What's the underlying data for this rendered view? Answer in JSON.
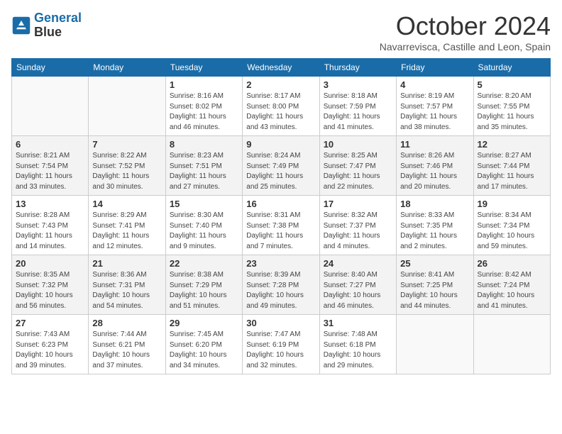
{
  "header": {
    "logo_line1": "General",
    "logo_line2": "Blue",
    "month": "October 2024",
    "location": "Navarrevisca, Castille and Leon, Spain"
  },
  "weekdays": [
    "Sunday",
    "Monday",
    "Tuesday",
    "Wednesday",
    "Thursday",
    "Friday",
    "Saturday"
  ],
  "weeks": [
    [
      {
        "day": "",
        "info": ""
      },
      {
        "day": "",
        "info": ""
      },
      {
        "day": "1",
        "info": "Sunrise: 8:16 AM\nSunset: 8:02 PM\nDaylight: 11 hours and 46 minutes."
      },
      {
        "day": "2",
        "info": "Sunrise: 8:17 AM\nSunset: 8:00 PM\nDaylight: 11 hours and 43 minutes."
      },
      {
        "day": "3",
        "info": "Sunrise: 8:18 AM\nSunset: 7:59 PM\nDaylight: 11 hours and 41 minutes."
      },
      {
        "day": "4",
        "info": "Sunrise: 8:19 AM\nSunset: 7:57 PM\nDaylight: 11 hours and 38 minutes."
      },
      {
        "day": "5",
        "info": "Sunrise: 8:20 AM\nSunset: 7:55 PM\nDaylight: 11 hours and 35 minutes."
      }
    ],
    [
      {
        "day": "6",
        "info": "Sunrise: 8:21 AM\nSunset: 7:54 PM\nDaylight: 11 hours and 33 minutes."
      },
      {
        "day": "7",
        "info": "Sunrise: 8:22 AM\nSunset: 7:52 PM\nDaylight: 11 hours and 30 minutes."
      },
      {
        "day": "8",
        "info": "Sunrise: 8:23 AM\nSunset: 7:51 PM\nDaylight: 11 hours and 27 minutes."
      },
      {
        "day": "9",
        "info": "Sunrise: 8:24 AM\nSunset: 7:49 PM\nDaylight: 11 hours and 25 minutes."
      },
      {
        "day": "10",
        "info": "Sunrise: 8:25 AM\nSunset: 7:47 PM\nDaylight: 11 hours and 22 minutes."
      },
      {
        "day": "11",
        "info": "Sunrise: 8:26 AM\nSunset: 7:46 PM\nDaylight: 11 hours and 20 minutes."
      },
      {
        "day": "12",
        "info": "Sunrise: 8:27 AM\nSunset: 7:44 PM\nDaylight: 11 hours and 17 minutes."
      }
    ],
    [
      {
        "day": "13",
        "info": "Sunrise: 8:28 AM\nSunset: 7:43 PM\nDaylight: 11 hours and 14 minutes."
      },
      {
        "day": "14",
        "info": "Sunrise: 8:29 AM\nSunset: 7:41 PM\nDaylight: 11 hours and 12 minutes."
      },
      {
        "day": "15",
        "info": "Sunrise: 8:30 AM\nSunset: 7:40 PM\nDaylight: 11 hours and 9 minutes."
      },
      {
        "day": "16",
        "info": "Sunrise: 8:31 AM\nSunset: 7:38 PM\nDaylight: 11 hours and 7 minutes."
      },
      {
        "day": "17",
        "info": "Sunrise: 8:32 AM\nSunset: 7:37 PM\nDaylight: 11 hours and 4 minutes."
      },
      {
        "day": "18",
        "info": "Sunrise: 8:33 AM\nSunset: 7:35 PM\nDaylight: 11 hours and 2 minutes."
      },
      {
        "day": "19",
        "info": "Sunrise: 8:34 AM\nSunset: 7:34 PM\nDaylight: 10 hours and 59 minutes."
      }
    ],
    [
      {
        "day": "20",
        "info": "Sunrise: 8:35 AM\nSunset: 7:32 PM\nDaylight: 10 hours and 56 minutes."
      },
      {
        "day": "21",
        "info": "Sunrise: 8:36 AM\nSunset: 7:31 PM\nDaylight: 10 hours and 54 minutes."
      },
      {
        "day": "22",
        "info": "Sunrise: 8:38 AM\nSunset: 7:29 PM\nDaylight: 10 hours and 51 minutes."
      },
      {
        "day": "23",
        "info": "Sunrise: 8:39 AM\nSunset: 7:28 PM\nDaylight: 10 hours and 49 minutes."
      },
      {
        "day": "24",
        "info": "Sunrise: 8:40 AM\nSunset: 7:27 PM\nDaylight: 10 hours and 46 minutes."
      },
      {
        "day": "25",
        "info": "Sunrise: 8:41 AM\nSunset: 7:25 PM\nDaylight: 10 hours and 44 minutes."
      },
      {
        "day": "26",
        "info": "Sunrise: 8:42 AM\nSunset: 7:24 PM\nDaylight: 10 hours and 41 minutes."
      }
    ],
    [
      {
        "day": "27",
        "info": "Sunrise: 7:43 AM\nSunset: 6:23 PM\nDaylight: 10 hours and 39 minutes."
      },
      {
        "day": "28",
        "info": "Sunrise: 7:44 AM\nSunset: 6:21 PM\nDaylight: 10 hours and 37 minutes."
      },
      {
        "day": "29",
        "info": "Sunrise: 7:45 AM\nSunset: 6:20 PM\nDaylight: 10 hours and 34 minutes."
      },
      {
        "day": "30",
        "info": "Sunrise: 7:47 AM\nSunset: 6:19 PM\nDaylight: 10 hours and 32 minutes."
      },
      {
        "day": "31",
        "info": "Sunrise: 7:48 AM\nSunset: 6:18 PM\nDaylight: 10 hours and 29 minutes."
      },
      {
        "day": "",
        "info": ""
      },
      {
        "day": "",
        "info": ""
      }
    ]
  ]
}
